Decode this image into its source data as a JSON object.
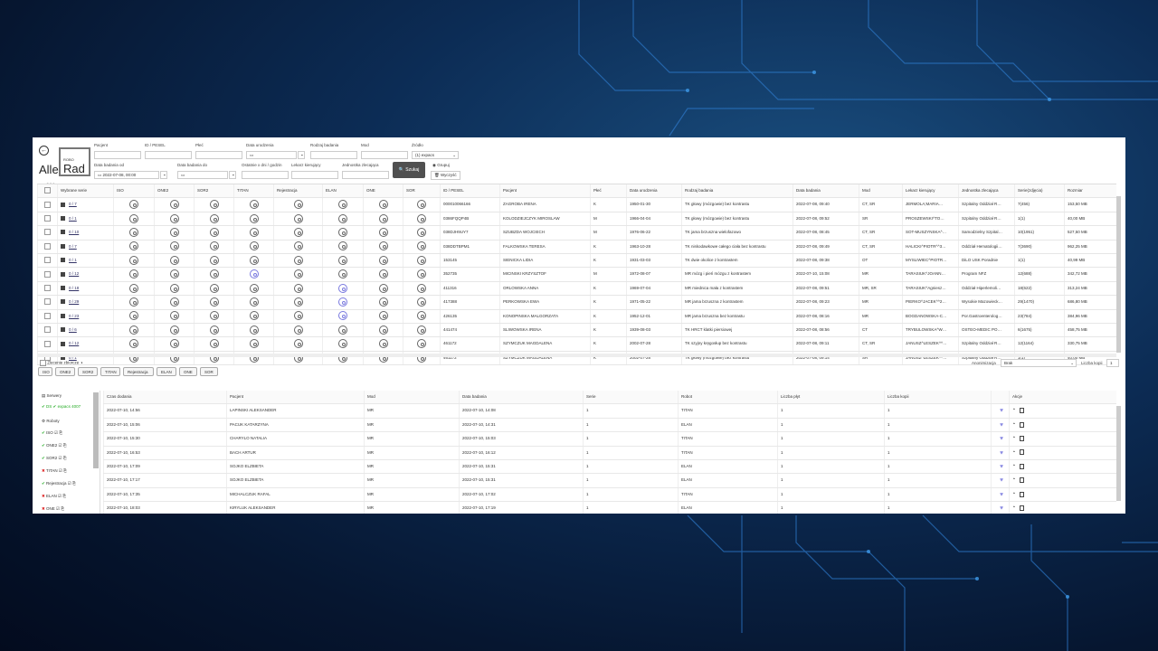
{
  "app": {
    "brand_alle": "Alle",
    "brand_robo": "ROBO",
    "brand_rad": "Rad",
    "version": "ver. 2.0.9"
  },
  "filters": {
    "pacjent": "Pacjent",
    "id_pesel": "ID / PESEL",
    "plec": "Płeć",
    "data_urodzenia": "Data urodzenia",
    "rodzaj_badania": "Rodzaj badania",
    "mod": "Mod",
    "zrodlo": "Źródło",
    "zrodlo_value": "(1) expacs",
    "data_od": "Data badania od",
    "data_od_value": "2022-07-08, 00:00",
    "data_do": "Data badania do",
    "ostatnie": "Ostatnie x dni / godzin",
    "lekarz": "Lekarz kierujący",
    "jednostka": "Jednostka zlecająca",
    "search": "Szukaj",
    "grupuj": "Grupuj",
    "wyczysc": "Wyczyść"
  },
  "table": {
    "headers": [
      "Wybrane serie",
      "ISO",
      "ONE2",
      "SOR2",
      "TITAN",
      "Rejestracja",
      "ELAN",
      "ONE",
      "SOR",
      "ID / PESEL",
      "Pacjent",
      "Płeć",
      "Data urodzenia",
      "Rodzaj badania",
      "Data badania",
      "Mod",
      "Lekarz kierujący",
      "Jednostka zlecająca",
      "Serie(zdjęcia)",
      "Rozmiar"
    ],
    "rows": [
      {
        "serie": "0 / 7",
        "id": "000010066166",
        "pacjent": "ZAGROBA IRENA",
        "plec": "K",
        "ur": "1950-01-30",
        "rodzaj": "TK głowy (mózgowie) bez kontrastu",
        "data": "2022-07-08, 09:40",
        "mod": "CT, SR",
        "lekarz": "JERMOLA;MARIA…",
        "jedn": "Szpitalny Oddział R…",
        "serie_z": "7(456)",
        "rozmiar": "153,50 MB",
        "blue": []
      },
      {
        "serie": "0 / 1",
        "id": "0386FQQP4B",
        "pacjent": "KOLODZIEJCZYK MIROSLAW",
        "plec": "M",
        "ur": "1966-04-04",
        "rodzaj": "TK głowy (mózgowie) bez kontrastu",
        "data": "2022-07-08, 09:52",
        "mod": "SR",
        "lekarz": "PROSZEWSKI^TO…",
        "jedn": "Szpitalny Oddział R…",
        "serie_z": "1(1)",
        "rozmiar": "40,00 MB",
        "blue": []
      },
      {
        "serie": "0 / 10",
        "id": "038DJH9UY7",
        "pacjent": "SZUBZDA WOJCIECH",
        "plec": "M",
        "ur": "1976-06-22",
        "rodzaj": "TK jama brzuszna wielofazowo",
        "data": "2022-07-08, 08:45",
        "mod": "CT, SR",
        "lekarz": "SOT-MUSZYNSKA^…",
        "jedn": "Samodzielny Szpital…",
        "serie_z": "10(1951)",
        "rozmiar": "527,50 MB",
        "blue": []
      },
      {
        "serie": "0 / 7",
        "id": "038DDTBPM1",
        "pacjent": "FALKOWSKA TERESA",
        "plec": "K",
        "ur": "1963-10-28",
        "rodzaj": "TK niskodawkowe całego ciała bez kontrastu",
        "data": "2022-07-08, 09:49",
        "mod": "CT, SR",
        "lekarz": "HALICKI^PIOTR^^3…",
        "jedn": "Oddział Hematologii…",
        "serie_z": "7(3690)",
        "rozmiar": "962,25 MB",
        "blue": []
      },
      {
        "serie": "0 / 1",
        "id": "153145",
        "pacjent": "SIENICKA LIDIA",
        "plec": "K",
        "ur": "1931-03-03",
        "rodzaj": "TK dwie okolice z kontrastem",
        "data": "2022-07-08, 09:38",
        "mod": "OT",
        "lekarz": "MYSLIWIEC^PIOTR…",
        "jedn": "DiLO USK Poradnie",
        "serie_z": "1(1)",
        "rozmiar": "40,99 MB",
        "blue": []
      },
      {
        "serie": "0 / 12",
        "id": "352735",
        "pacjent": "MICINSKI KRZYSZTOF",
        "plec": "M",
        "ur": "1972-08-07",
        "rodzaj": "MR mózg i pień mózgu z kontrastem",
        "data": "2022-07-10, 15:08",
        "mod": "MR",
        "lekarz": "TARASIUK^JOANN…",
        "jedn": "Program NFZ",
        "serie_z": "12(688)",
        "rozmiar": "342,72 MB",
        "blue": [
          "TITAN"
        ]
      },
      {
        "serie": "0 / 18",
        "id": "411316",
        "pacjent": "ORLOWSKA ANNA",
        "plec": "K",
        "ur": "1969-07-04",
        "rodzaj": "MR miednica mała z kontrastem",
        "data": "2022-07-08, 09:51",
        "mod": "MR, SR",
        "lekarz": "TARASIUK^Agniesz…",
        "jedn": "Oddział Hiperlemoli…",
        "serie_z": "18(622)",
        "rozmiar": "313,24 MB",
        "blue": [
          "ELAN"
        ]
      },
      {
        "serie": "0 / 29",
        "id": "417388",
        "pacjent": "PERKOWSKA EWA",
        "plec": "K",
        "ur": "1971-05-22",
        "rodzaj": "MR jama brzuszna z kontrastem",
        "data": "2022-07-08, 09:23",
        "mod": "MR",
        "lekarz": "PIERKO^JACEK^^2…",
        "jedn": "Wysokie Mazowieck…",
        "serie_z": "29(1470)",
        "rozmiar": "686,80 MB",
        "blue": [
          "ELAN"
        ]
      },
      {
        "serie": "0 / 23",
        "id": "426135",
        "pacjent": "KONOPINSKA MALGORZATA",
        "plec": "K",
        "ur": "1952-12-01",
        "rodzaj": "MR jama brzuszna bez kontrastu",
        "data": "2022-07-08, 08:16",
        "mod": "MR",
        "lekarz": "BOGDANOWSKA-C…",
        "jedn": "Por.Gastroenterolog…",
        "serie_z": "23(784)",
        "rozmiar": "384,96 MB",
        "blue": [
          "ELAN"
        ]
      },
      {
        "serie": "0 / 6",
        "id": "441474",
        "pacjent": "SLIWOWSKA IRENA",
        "plec": "K",
        "ur": "1939-08-03",
        "rodzaj": "TK HRCT klatki piersiowej",
        "data": "2022-07-08, 08:56",
        "mod": "CT",
        "lekarz": "TRYBULOWSKA^W…",
        "jedn": "OSTEO-MEDIC PO…",
        "serie_z": "6(1675)",
        "rozmiar": "458,75 MB",
        "blue": []
      },
      {
        "serie": "0 / 12",
        "id": "461172",
        "pacjent": "SZYMCZUK MAGDALENA",
        "plec": "K",
        "ur": "2002-07-28",
        "rodzaj": "TK szyjny kręgosłup bez kontrastu",
        "data": "2022-07-08, 09:11",
        "mod": "CT, SR",
        "lekarz": "JANUSZ^LESZEK^^…",
        "jedn": "Szpitalny Oddział R…",
        "serie_z": "12(1164)",
        "rozmiar": "330,75 MB",
        "blue": []
      },
      {
        "serie": "0 / 1",
        "id": "461172",
        "pacjent": "SZYMCZUK MAGDALENA",
        "plec": "K",
        "ur": "2002-07-28",
        "rodzaj": "TK głowy (mózgowie) bez kontrastu",
        "data": "2022-07-08, 09:14",
        "mod": "SR",
        "lekarz": "JANUSZ^LESZEK^^…",
        "jedn": "Szpitalny Oddział R…",
        "serie_z": "1(1)",
        "rozmiar": "40,00 MB",
        "blue": []
      }
    ]
  },
  "bottom_bar": {
    "zlecenie": "Zlecenie zbiorcze",
    "robots": [
      "ISO",
      "ONE2",
      "SOR2",
      "TITAN",
      "Rejestracja",
      "ELAN",
      "ONE",
      "SOR"
    ],
    "anonimizacja": "Anonimizacja",
    "anon_value": "Brak",
    "liczba_kopii": "Liczba kopii",
    "kopii_value": "1"
  },
  "side": {
    "serwery": "Serwery",
    "server1": "DS",
    "server1b": "expacs 4007",
    "roboty": "Roboty",
    "robots": [
      {
        "name": "ISO",
        "ok": true
      },
      {
        "name": "ONE2",
        "ok": true
      },
      {
        "name": "SOR2",
        "ok": true
      },
      {
        "name": "TITAN",
        "ok": false
      },
      {
        "name": "Rejestracja",
        "ok": true
      },
      {
        "name": "ELAN",
        "ok": false
      },
      {
        "name": "ONE",
        "ok": false
      }
    ]
  },
  "jobs": {
    "headers": [
      "Czas dodania",
      "Pacjent",
      "Mod",
      "Data badania",
      "Serie",
      "Robot",
      "Liczba płyt",
      "Liczba kopii",
      "Akcje"
    ],
    "rows": [
      {
        "czas": "2022-07-10, 14:56",
        "pacjent": "LAPINSKI ALEKSANDER",
        "mod": "MR",
        "data": "2022-07-10, 14:08",
        "serie": "1",
        "robot": "TITAN",
        "plyt": "1",
        "kopii": "1"
      },
      {
        "czas": "2022-07-10, 15:06",
        "pacjent": "PACUK KATARZYNA",
        "mod": "MR",
        "data": "2022-07-10, 14:31",
        "serie": "1",
        "robot": "ELAN",
        "plyt": "1",
        "kopii": "1"
      },
      {
        "czas": "2022-07-10, 15:30",
        "pacjent": "CHARYLO NATALIA",
        "mod": "MR",
        "data": "2022-07-10, 15:03",
        "serie": "1",
        "robot": "TITAN",
        "plyt": "1",
        "kopii": "1"
      },
      {
        "czas": "2022-07-10, 16:53",
        "pacjent": "BACH ARTUR",
        "mod": "MR",
        "data": "2022-07-10, 16:12",
        "serie": "1",
        "robot": "TITAN",
        "plyt": "1",
        "kopii": "1"
      },
      {
        "czas": "2022-07-10, 17:09",
        "pacjent": "SOJKO ELZBIETA",
        "mod": "MR",
        "data": "2022-07-10, 15:31",
        "serie": "1",
        "robot": "ELAN",
        "plyt": "1",
        "kopii": "1"
      },
      {
        "czas": "2022-07-10, 17:17",
        "pacjent": "SOJKO ELZBIETA",
        "mod": "MR",
        "data": "2022-07-10, 15:31",
        "serie": "1",
        "robot": "ELAN",
        "plyt": "1",
        "kopii": "1"
      },
      {
        "czas": "2022-07-10, 17:35",
        "pacjent": "MICHALCZUK RAFAL",
        "mod": "MR",
        "data": "2022-07-10, 17:02",
        "serie": "1",
        "robot": "TITAN",
        "plyt": "1",
        "kopii": "1"
      },
      {
        "czas": "2022-07-10, 18:03",
        "pacjent": "KIRYLUK ALEKSANDER",
        "mod": "MR",
        "data": "2022-07-10, 17:19",
        "serie": "1",
        "robot": "ELAN",
        "plyt": "1",
        "kopii": "1"
      }
    ]
  }
}
